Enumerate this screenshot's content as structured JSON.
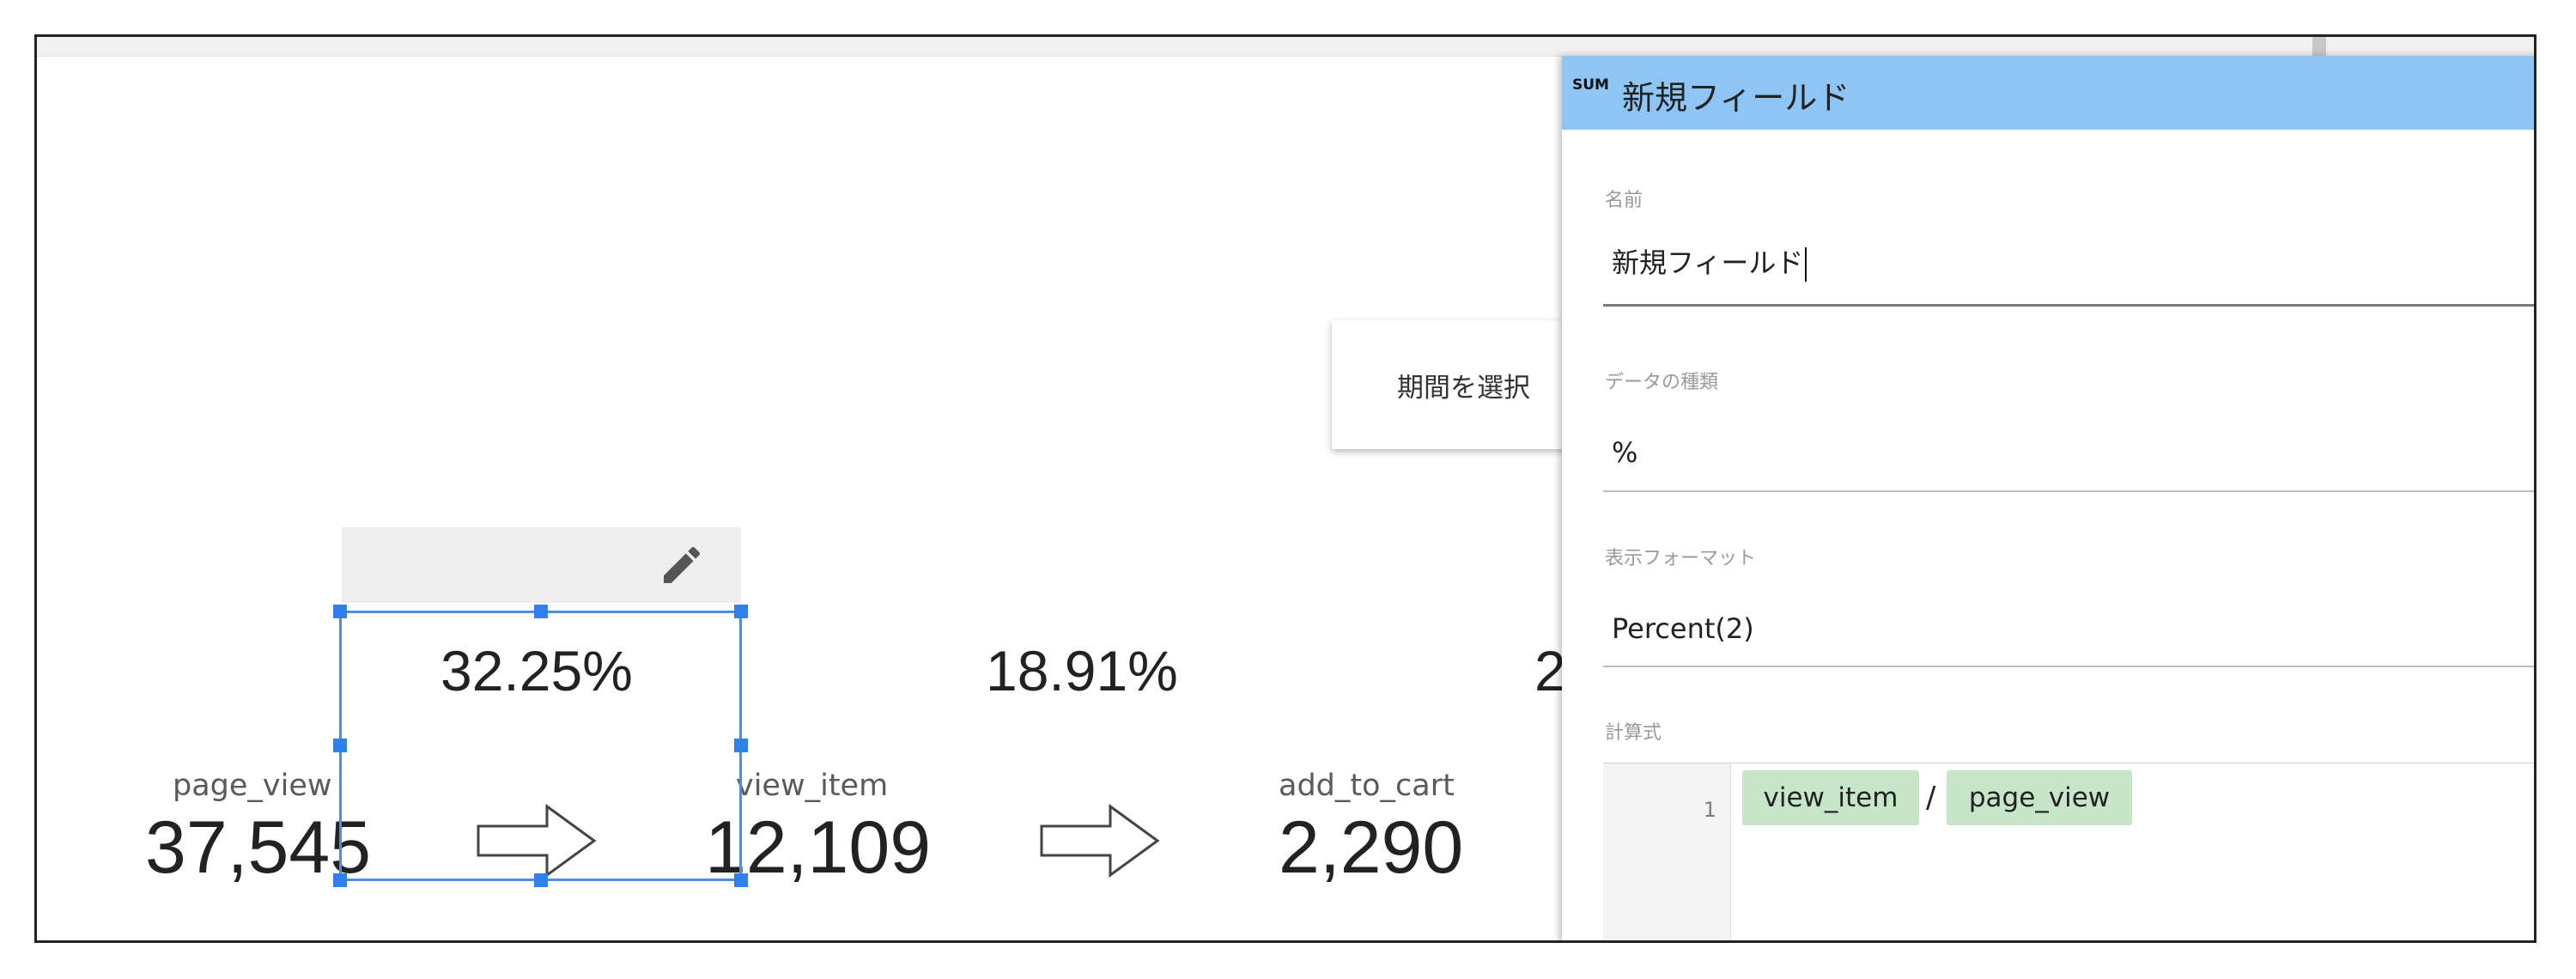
{
  "canvas": {
    "date_control_label": "期間を選択"
  },
  "funnel": {
    "rates": [
      "32.25%",
      "18.91%",
      "2"
    ],
    "steps": [
      {
        "label": "page_view",
        "value": "37,545"
      },
      {
        "label": "view_item",
        "value": "12,109"
      },
      {
        "label": "add_to_cart",
        "value": "2,290"
      }
    ]
  },
  "icons": {
    "edit": "pencil-icon",
    "step_arrow": "outlined-right-arrow-icon"
  },
  "panel": {
    "badge": "SUM",
    "title": "新規フィールド",
    "header_color": "#8ec5f5",
    "fields": {
      "name": {
        "label": "名前",
        "value": "新規フィールド"
      },
      "data_type": {
        "label": "データの種類",
        "value": "%"
      },
      "display_format": {
        "label": "表示フォーマット",
        "value": "Percent(2)"
      },
      "formula": {
        "label": "計算式",
        "line_number": "1",
        "tokens": [
          "view_item",
          "page_view"
        ],
        "operator": "/"
      }
    }
  },
  "colors": {
    "selection": "#4a90e2",
    "formula_token": "#c7e6c9"
  }
}
